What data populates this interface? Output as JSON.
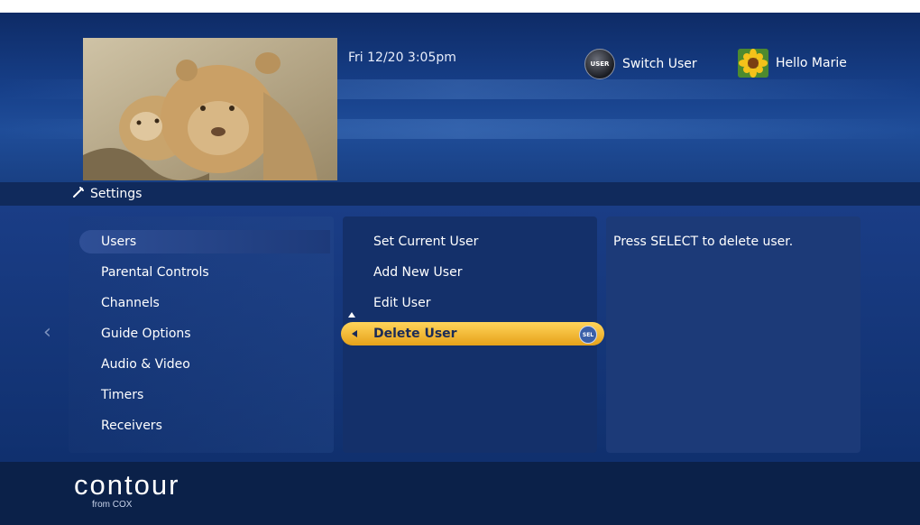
{
  "header": {
    "datetime": "Fri 12/20  3:05pm",
    "switch_user_label": "Switch User",
    "user_badge_text": "USER",
    "greeting": "Hello Marie"
  },
  "breadcrumb": {
    "title": "Settings"
  },
  "left_menu": {
    "items": [
      "Users",
      "Parental Controls",
      "Channels",
      "Guide Options",
      "Audio & Video",
      "Timers",
      "Receivers"
    ],
    "selected": "Users"
  },
  "sub_menu": {
    "items": [
      "Set Current User",
      "Add New User",
      "Edit User",
      "Delete User"
    ],
    "selected": "Delete User",
    "select_badge": "SEL"
  },
  "help_text": "Press SELECT to delete user.",
  "brand": {
    "logo": "contour",
    "sub": "from COX"
  },
  "icons": {
    "settings": "wrench-icon",
    "nav_left": "chevron-left-icon"
  },
  "colors": {
    "accent": "#f2b632",
    "background": "#0b1e4a"
  }
}
